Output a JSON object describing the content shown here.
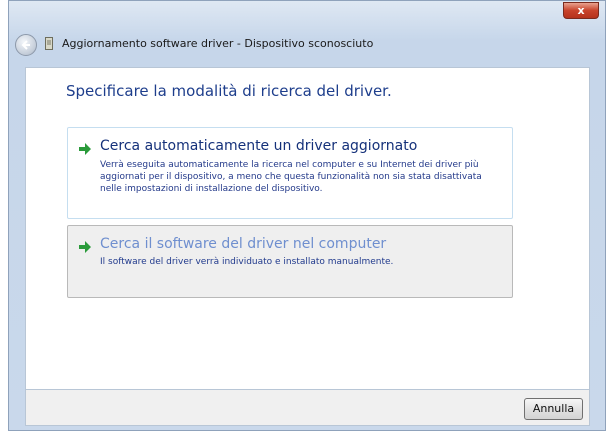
{
  "window": {
    "title": "Aggiornamento software driver - Dispositivo sconosciuto",
    "close_label": "x"
  },
  "main": {
    "heading": "Specificare la modalità di ricerca del driver.",
    "options": [
      {
        "title": "Cerca automaticamente un driver aggiornato",
        "description": "Verrà eseguita automaticamente la ricerca nel computer e su Internet dei driver più aggiornati per il dispositivo, a meno che questa funzionalità non sia stata disattivata nelle impostazioni di installazione del dispositivo."
      },
      {
        "title": "Cerca il software del driver nel computer",
        "description": "Il software del driver verrà individuato e installato manualmente."
      }
    ]
  },
  "footer": {
    "cancel_label": "Annulla"
  },
  "colors": {
    "heading": "#1e3e8c",
    "option_title": "#15317a",
    "arrow": "#2a9a3a",
    "close_button": "#c8432b"
  },
  "icons": {
    "back": "back-arrow-icon",
    "device": "device-icon",
    "option_arrow": "green-arrow-icon"
  }
}
